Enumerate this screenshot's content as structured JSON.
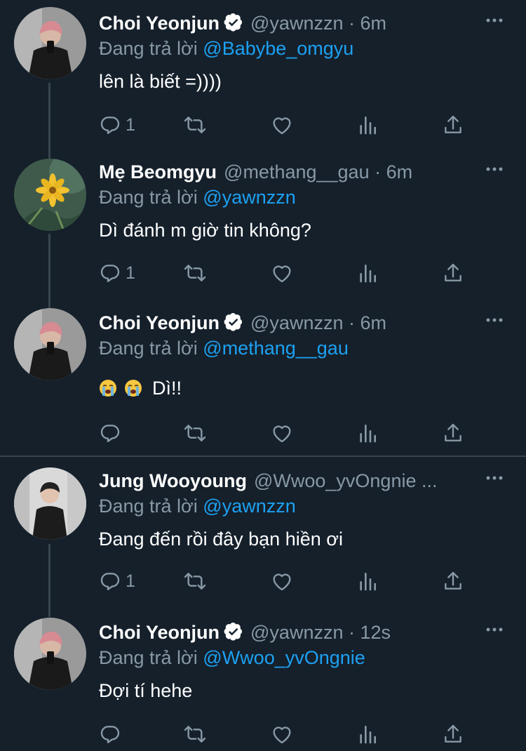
{
  "tweets": [
    {
      "name": "Choi Yeonjun",
      "handle": "@yawnzzn · 6m",
      "reply_prefix": "Đang trả lời",
      "reply_to": "@Babybe_omgyu",
      "text": "lên là biết =))))",
      "reply_count": "1",
      "verified": true
    },
    {
      "name": "Mẹ Beomgyu",
      "handle": "@methang__gau · 6m",
      "reply_prefix": "Đang trả lời",
      "reply_to": "@yawnzzn",
      "text": "Dì đánh m giờ tin không?",
      "reply_count": "1",
      "verified": false
    },
    {
      "name": "Choi Yeonjun",
      "handle": "@yawnzzn · 6m",
      "reply_prefix": "Đang trả lời",
      "reply_to": "@methang__gau",
      "text": "Dì!!",
      "reply_count": "",
      "verified": true,
      "emoji": [
        "loudly-crying-face-emoji",
        "loudly-crying-face-emoji"
      ]
    },
    {
      "name": "Jung Wooyoung",
      "handle": "@Wwoo_yvOngnie ...",
      "reply_prefix": "Đang trả lời",
      "reply_to": "@yawnzzn",
      "text": "Đang đến rồi đây bạn hiền ơi",
      "reply_count": "1",
      "verified": false
    },
    {
      "name": "Choi Yeonjun",
      "handle": "@yawnzzn · 12s",
      "reply_prefix": "Đang trả lời",
      "reply_to": "@Wwoo_yvOngnie",
      "text": "Đợi tí hehe",
      "reply_count": "",
      "verified": true
    }
  ],
  "colors": {
    "background": "#15202b",
    "text": "#ffffff",
    "secondary": "#8899a6",
    "link": "#1da1f2",
    "divider": "#38444d"
  },
  "icons": [
    "verified-badge-icon",
    "more-icon",
    "reply-icon",
    "retweet-icon",
    "like-icon",
    "analytics-icon",
    "share-icon"
  ]
}
